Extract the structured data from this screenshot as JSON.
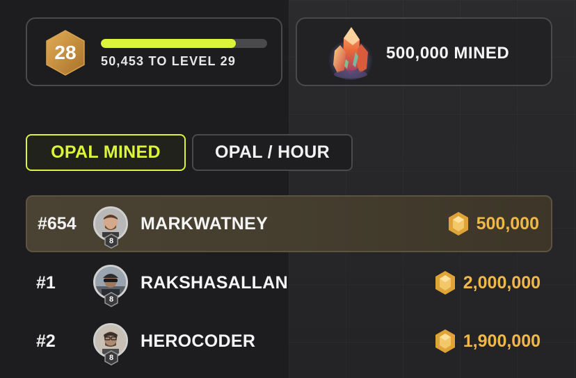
{
  "level": {
    "number": "28",
    "progress": 0.81,
    "progress_text": "50,453 TO LEVEL 29"
  },
  "mined": {
    "text": "500,000 MINED"
  },
  "tabs": [
    {
      "label": "OPAL MINED",
      "active": true
    },
    {
      "label": "OPAL / HOUR",
      "active": false
    }
  ],
  "leaderboard": [
    {
      "rank": "#654",
      "username": "MARKWATNEY",
      "badge": "8",
      "score": "500,000",
      "current": true
    },
    {
      "rank": "#1",
      "username": "RAKSHASALLAN",
      "badge": "8",
      "score": "2,000,000",
      "current": false
    },
    {
      "rank": "#2",
      "username": "HEROCODER",
      "badge": "8",
      "score": "1,900,000",
      "current": false
    }
  ],
  "colors": {
    "accent": "#dcf53a",
    "score": "#f0b84a",
    "level_badge": "#c9913e"
  },
  "icons": {
    "level": "hexagon-badge-icon",
    "gem": "opal-crystal-icon",
    "score": "opal-coin-icon"
  }
}
